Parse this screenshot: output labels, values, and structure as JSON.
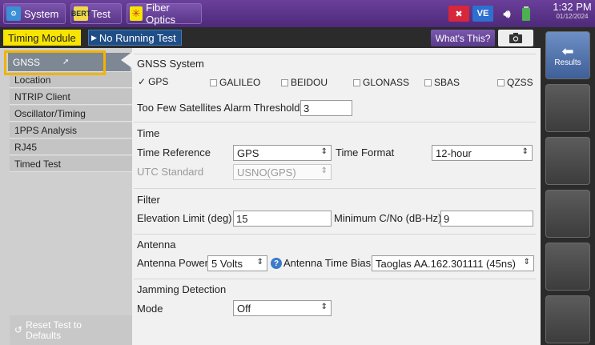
{
  "topbar": {
    "system_label": "System",
    "test_label": "Test",
    "test_icon_text": "BERT",
    "fiber_label": "Fiber Optics",
    "time": "1:32 PM",
    "date": "01/12/2024",
    "ve_badge": "VE"
  },
  "subbar": {
    "module_tab": "Timing Module",
    "running_test": "No Running Test",
    "whats_this": "What's This?"
  },
  "nav": {
    "items": [
      "GNSS",
      "Location",
      "NTRIP Client",
      "Oscillator/Timing",
      "1PPS Analysis",
      "RJ45",
      "Timed Test"
    ],
    "reset": "Reset Test to Defaults"
  },
  "results_label": "Results",
  "gnss": {
    "title": "GNSS System",
    "constellations": [
      "GPS",
      "GALILEO",
      "BEIDOU",
      "GLONASS",
      "SBAS",
      "QZSS"
    ],
    "threshold_label": "Too Few Satellites Alarm Threshold",
    "threshold_value": "3"
  },
  "time": {
    "title": "Time",
    "reference_label": "Time Reference",
    "reference_value": "GPS",
    "format_label": "Time Format",
    "format_value": "12-hour",
    "utc_label": "UTC Standard",
    "utc_value": "USNO(GPS)"
  },
  "filter": {
    "title": "Filter",
    "elevation_label": "Elevation Limit (deg)",
    "elevation_value": "15",
    "cno_label": "Minimum C/No (dB-Hz)",
    "cno_value": "9"
  },
  "antenna": {
    "title": "Antenna",
    "power_label": "Antenna Power",
    "power_value": "5 Volts",
    "bias_label": "Antenna Time Bias",
    "bias_value": "Taoglas AA.162.301111 (45ns)"
  },
  "jamming": {
    "title": "Jamming Detection",
    "mode_label": "Mode",
    "mode_value": "Off"
  },
  "colors": {
    "topbar": "#5a3588",
    "module_tab": "#f7e400",
    "highlight": "#f0b400",
    "nav_selected": "#7d8894"
  }
}
